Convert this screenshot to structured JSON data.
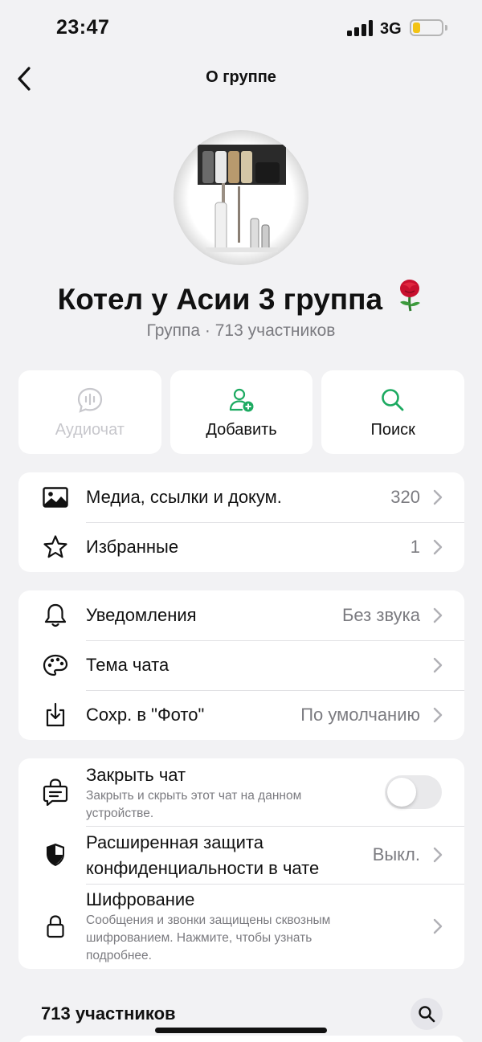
{
  "status_bar": {
    "time": "23:47",
    "network": "3G",
    "battery_level": 0.25,
    "battery_color": "#f2c315"
  },
  "nav": {
    "title": "О группе",
    "back_icon": "chevron-left-icon"
  },
  "group": {
    "name": "Котел у Асии 3 группа",
    "name_emoji": "rose-emoji",
    "subtitle": "Группа · 713 участников"
  },
  "actions": [
    {
      "label": "Аудиочат",
      "icon": "audio-chat-icon",
      "enabled": false
    },
    {
      "label": "Добавить",
      "icon": "add-user-icon",
      "enabled": true
    },
    {
      "label": "Поиск",
      "icon": "search-icon",
      "enabled": true
    }
  ],
  "media_card": [
    {
      "label": "Медиа, ссылки и докум.",
      "value": "320",
      "icon": "photo-icon"
    },
    {
      "label": "Избранные",
      "value": "1",
      "icon": "star-icon"
    }
  ],
  "settings_card": [
    {
      "label": "Уведомления",
      "value": "Без звука",
      "icon": "bell-icon"
    },
    {
      "label": "Тема чата",
      "value": "",
      "icon": "palette-icon"
    },
    {
      "label": "Сохр. в \"Фото\"",
      "value": "По умолчанию",
      "icon": "download-icon"
    }
  ],
  "privacy_card": {
    "lock_chat": {
      "title": "Закрыть чат",
      "description_line1": "Закрыть и скрыть этот чат на данном",
      "description_line2": "устройстве.",
      "toggle_on": false,
      "icon": "chat-lock-icon"
    },
    "advanced_privacy": {
      "title_line1": "Расширенная защита",
      "title_line2": "конфиденциальности в чате",
      "value": "Выкл.",
      "icon": "shield-icon"
    },
    "encryption": {
      "title": "Шифрование",
      "description_line1": "Сообщения и звонки защищены сквозным",
      "description_line2": "шифрованием. Нажмите, чтобы узнать",
      "description_line3": "подробнее.",
      "icon": "lock-icon"
    }
  },
  "members": {
    "header": "713 участников",
    "search_icon": "search-icon"
  },
  "colors": {
    "accent": "#1daa61",
    "background": "#f2f2f4",
    "card": "#ffffff",
    "secondary_text": "#7b7b80",
    "disabled": "#c7c7cc"
  }
}
